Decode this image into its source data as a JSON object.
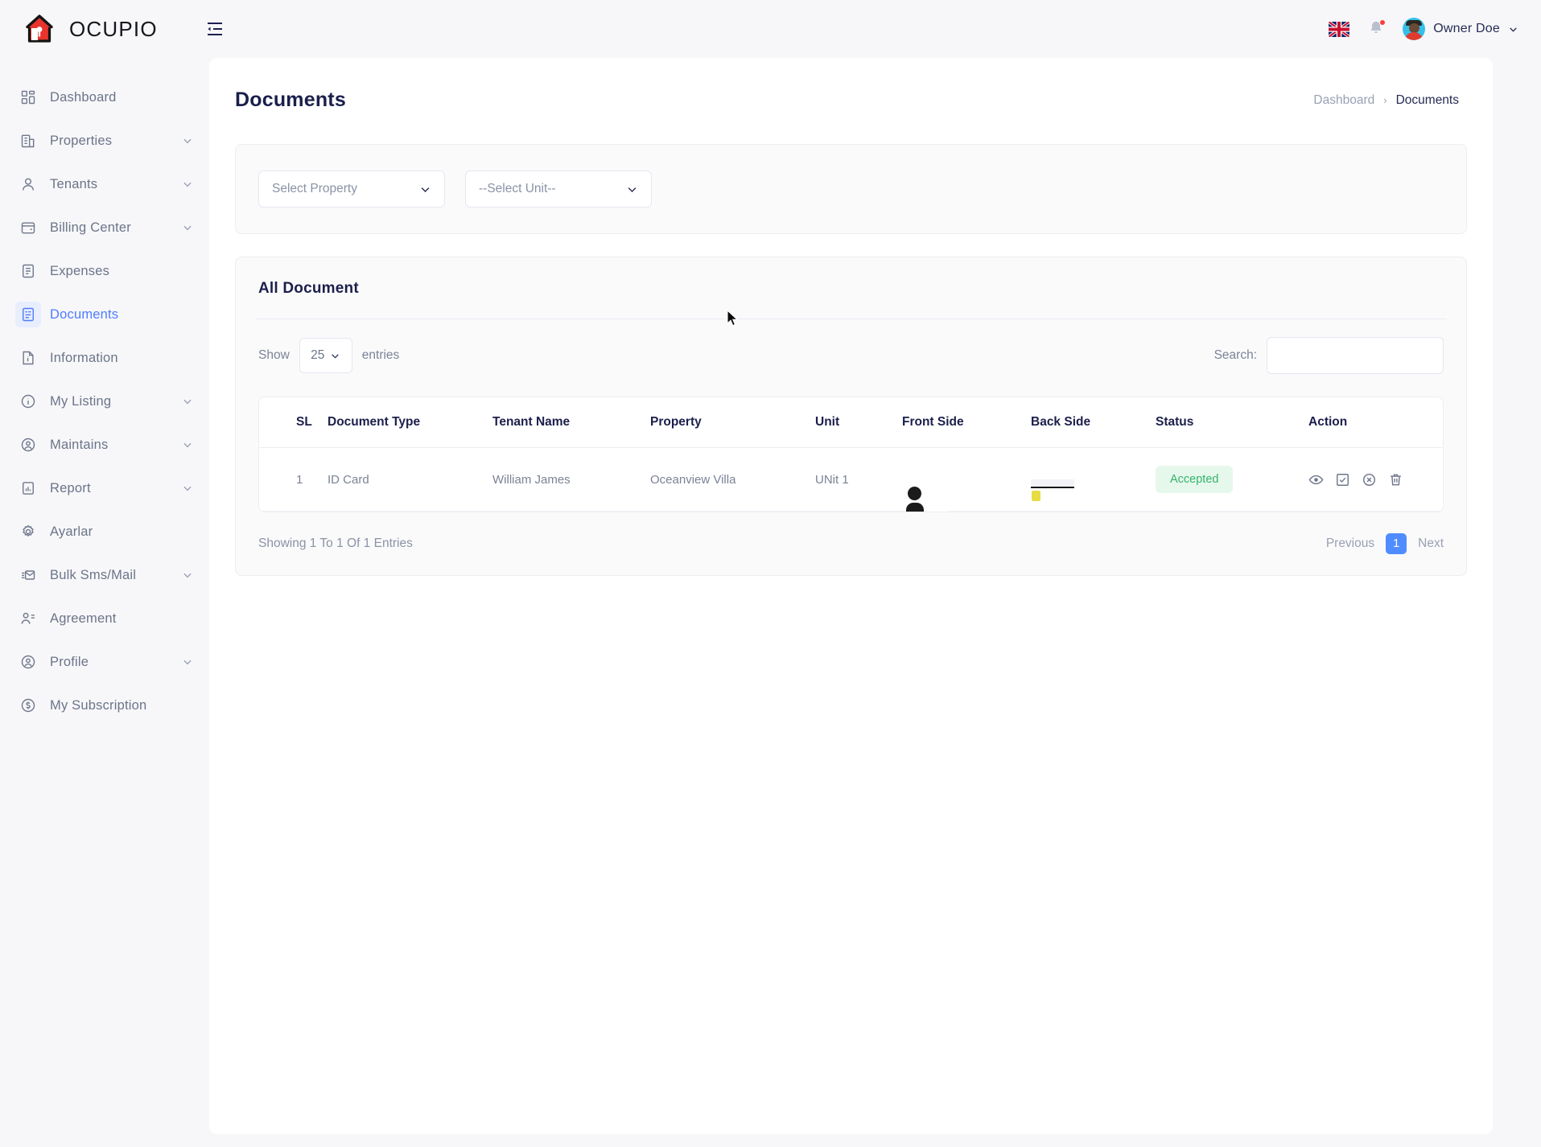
{
  "brand": {
    "name": "OCUPIO",
    "logo_icon": "house-key-logo"
  },
  "topbar": {
    "collapse_icon": "sidebar-collapse-icon",
    "language_icon": "uk-flag-icon",
    "notification_icon": "bell-icon",
    "user_name": "Owner Doe",
    "user_caret_icon": "chevron-down-icon",
    "avatar_icon": "user-avatar"
  },
  "sidebar": {
    "items": [
      {
        "label": "Dashboard",
        "icon": "grid-icon",
        "caret": false,
        "active": false
      },
      {
        "label": "Properties",
        "icon": "building-icon",
        "caret": true,
        "active": false
      },
      {
        "label": "Tenants",
        "icon": "user-icon",
        "caret": true,
        "active": false
      },
      {
        "label": "Billing Center",
        "icon": "wallet-icon",
        "caret": true,
        "active": false
      },
      {
        "label": "Expenses",
        "icon": "file-list-icon",
        "caret": false,
        "active": false
      },
      {
        "label": "Documents",
        "icon": "file-list-icon",
        "caret": false,
        "active": true
      },
      {
        "label": "Information",
        "icon": "info-file-icon",
        "caret": false,
        "active": false
      },
      {
        "label": "My Listing",
        "icon": "info-circle-icon",
        "caret": true,
        "active": false
      },
      {
        "label": "Maintains",
        "icon": "user-circle-icon",
        "caret": true,
        "active": false
      },
      {
        "label": "Report",
        "icon": "chart-file-icon",
        "caret": true,
        "active": false
      },
      {
        "label": "Ayarlar",
        "icon": "gear-icon",
        "caret": false,
        "active": false
      },
      {
        "label": "Bulk Sms/Mail",
        "icon": "mail-send-icon",
        "caret": true,
        "active": false
      },
      {
        "label": "Agreement",
        "icon": "user-list-icon",
        "caret": false,
        "active": false
      },
      {
        "label": "Profile",
        "icon": "user-circle-icon",
        "caret": true,
        "active": false
      },
      {
        "label": "My Subscription",
        "icon": "dollar-circle-icon",
        "caret": false,
        "active": false
      }
    ]
  },
  "page": {
    "title": "Documents",
    "breadcrumb": {
      "parent": "Dashboard",
      "separator": "›",
      "current": "Documents"
    }
  },
  "filters": {
    "property": {
      "value": "Select Property",
      "caret_icon": "chevron-down-icon"
    },
    "unit": {
      "value": "--Select Unit--",
      "caret_icon": "chevron-down-icon"
    }
  },
  "table_card": {
    "title": "All Document",
    "show_label": "Show",
    "entries_value": "25",
    "entries_label": "entries",
    "search_label": "Search:",
    "search_value": "",
    "search_placeholder": ""
  },
  "table": {
    "columns": [
      "SL",
      "Document Type",
      "Tenant Name",
      "Property",
      "Unit",
      "Front Side",
      "Back Side",
      "Status",
      "Action"
    ],
    "rows": [
      {
        "sl": "1",
        "document_type": "ID Card",
        "tenant_name": "William James",
        "property": "Oceanview Villa",
        "unit": "UNit 1",
        "front_side": "id-card-front-thumbnail",
        "back_side": "id-card-back-thumbnail",
        "status": "Accepted",
        "actions": [
          "eye-icon",
          "check-square-icon",
          "circle-x-icon",
          "trash-icon"
        ]
      }
    ]
  },
  "footer": {
    "showing_text": "Showing 1 To 1 Of 1 Entries",
    "previous_label": "Previous",
    "page_number": "1",
    "next_label": "Next"
  },
  "colors": {
    "accent": "#4f7cff",
    "page_bg": "#f7f7f9",
    "title": "#1b1f4b",
    "muted": "#8b92a6",
    "status_accepted_text": "#35b36b",
    "status_accepted_bg": "#e6f8ec",
    "pagination_active": "#4f8cff",
    "logo_red": "#e8342c"
  }
}
